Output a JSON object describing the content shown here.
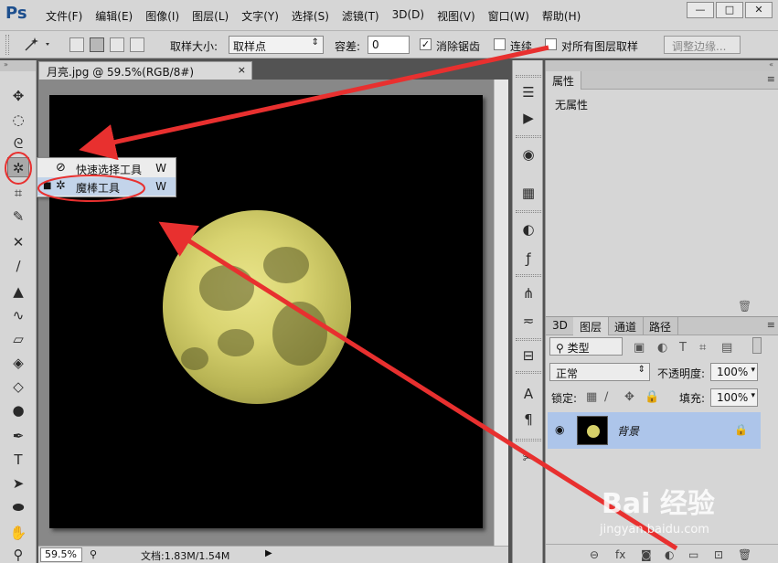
{
  "app": {
    "logo": "Ps"
  },
  "menu": [
    "文件(F)",
    "编辑(E)",
    "图像(I)",
    "图层(L)",
    "文字(Y)",
    "选择(S)",
    "滤镜(T)",
    "3D(D)",
    "视图(V)",
    "窗口(W)",
    "帮助(H)"
  ],
  "window_buttons": {
    "minimize": "—",
    "maximize": "□",
    "close": "✕"
  },
  "options": {
    "sample_size_label": "取样大小:",
    "sample_size_value": "取样点",
    "tolerance_label": "容差:",
    "tolerance_value": "0",
    "antialias_label": "消除锯齿",
    "antialias_checked": "✓",
    "contiguous_label": "连续",
    "all_layers_label": "对所有图层取样",
    "refine_edge_label": "调整边缘..."
  },
  "document": {
    "tab_title": "月亮.jpg @ 59.5%(RGB/8#)",
    "close_glyph": "×",
    "zoom": "59.5%",
    "doc_info": "文档:1.83M/1.54M"
  },
  "flyout": {
    "items": [
      {
        "label": "快速选择工具",
        "shortcut": "W",
        "icon": "quick-selection-icon",
        "selected": false
      },
      {
        "label": "魔棒工具",
        "shortcut": "W",
        "icon": "magic-wand-icon",
        "selected": true
      }
    ]
  },
  "properties_panel": {
    "tab": "属性",
    "body": "无属性"
  },
  "layers_panel": {
    "tabs": [
      "3D",
      "图层",
      "通道",
      "路径"
    ],
    "active_tab": "图层",
    "filter_label": "类型",
    "blend_mode": "正常",
    "opacity_label": "不透明度:",
    "opacity_value": "100%",
    "lock_label": "锁定:",
    "fill_label": "填充:",
    "fill_value": "100%",
    "layers": [
      {
        "name": "背景",
        "visible": true,
        "locked": true
      }
    ]
  },
  "watermark": {
    "main": "Bai 经验",
    "sub": "jingyan.baidu.com"
  },
  "colors": {
    "annotation_red": "#e8302f",
    "selection_blue": "#adc5ea",
    "ui_gray": "#d6d6d6",
    "moon_yellow": "#d8d370"
  }
}
